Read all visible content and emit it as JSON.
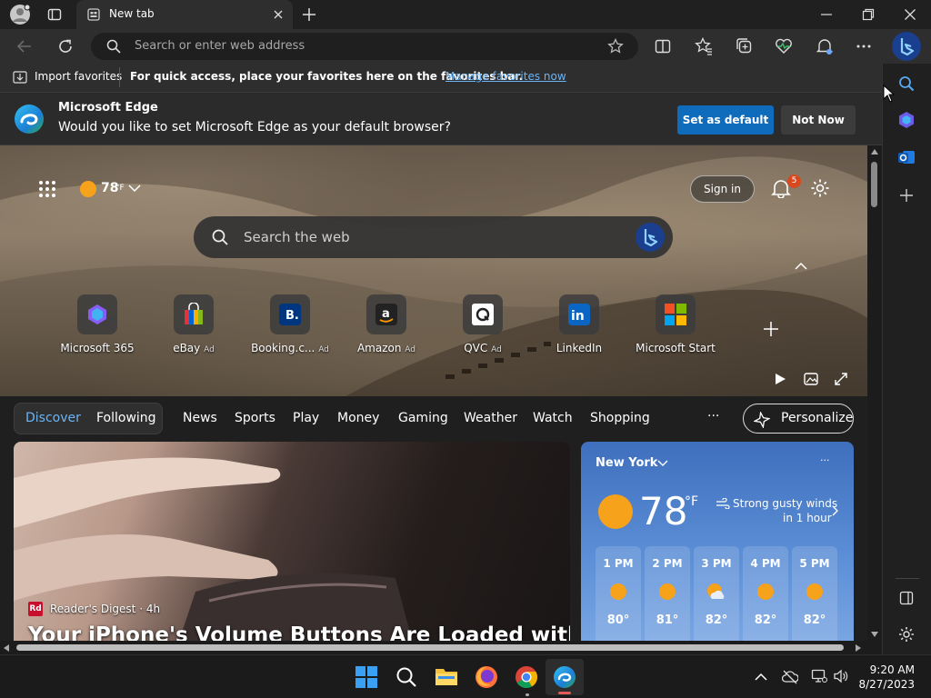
{
  "browser": {
    "tab_title": "New tab",
    "address_placeholder": "Search or enter web address"
  },
  "favorites_bar": {
    "import_label": "Import favorites",
    "hint": "For quick access, place your favorites here on the favorites bar.",
    "manage_link": "Manage favorites now"
  },
  "banner": {
    "title": "Microsoft Edge",
    "message": "Would you like to set Microsoft Edge as your default browser?",
    "set_default": "Set as default",
    "not_now": "Not Now"
  },
  "hero": {
    "temperature": "78",
    "temp_unit": "°F",
    "search_placeholder": "Search the web",
    "sign_in": "Sign in",
    "notification_count": "5"
  },
  "quick_links": [
    {
      "name": "Microsoft 365",
      "ad": ""
    },
    {
      "name": "eBay",
      "ad": "Ad"
    },
    {
      "name": "Booking.c...",
      "ad": "Ad"
    },
    {
      "name": "Amazon",
      "ad": "Ad"
    },
    {
      "name": "QVC",
      "ad": "Ad"
    },
    {
      "name": "LinkedIn",
      "ad": ""
    },
    {
      "name": "Microsoft Start",
      "ad": ""
    }
  ],
  "feed_nav": {
    "items": [
      "Discover",
      "Following",
      "News",
      "Sports",
      "Play",
      "Money",
      "Gaming",
      "Weather",
      "Watch",
      "Shopping"
    ],
    "more": "···",
    "personalize": "Personalize"
  },
  "article": {
    "source": "Reader's Digest",
    "age": "· 4h",
    "headline": "Your iPhone's Volume Buttons Are Loaded with"
  },
  "weather": {
    "city": "New York",
    "temp": "78",
    "unit": "°F",
    "alert_line1": "Strong gusty winds",
    "alert_line2": "in 1 hour",
    "menu": "···",
    "hours": [
      {
        "time": "1 PM",
        "temp": "80°"
      },
      {
        "time": "2 PM",
        "temp": "81°"
      },
      {
        "time": "3 PM",
        "temp": "82°"
      },
      {
        "time": "4 PM",
        "temp": "82°"
      },
      {
        "time": "5 PM",
        "temp": "82°"
      }
    ]
  },
  "taskbar": {
    "time": "9:20 AM",
    "date": "8/27/2023"
  },
  "colors": {
    "accent": "#0f6cbd",
    "link": "#6cb4f5",
    "weather_sun": "#f7a21b"
  }
}
